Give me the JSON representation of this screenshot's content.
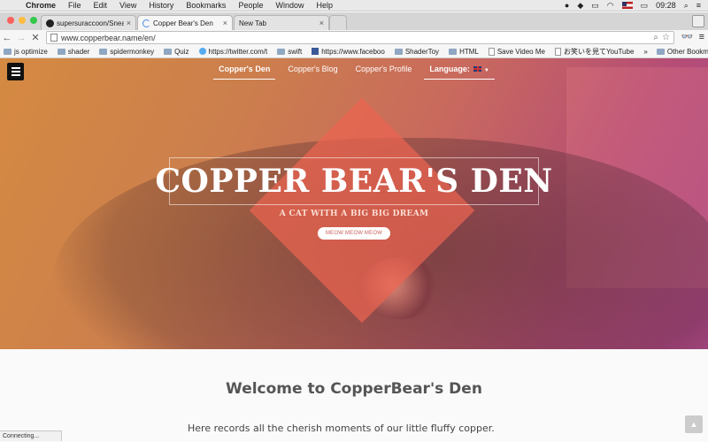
{
  "menubar": {
    "app": "Chrome",
    "items": [
      "File",
      "Edit",
      "View",
      "History",
      "Bookmarks",
      "People",
      "Window",
      "Help"
    ],
    "clock": "09:28"
  },
  "tabs": [
    {
      "title": "supersuraccoon/SneakyJo",
      "icon": "github-icon"
    },
    {
      "title": "Copper Bear's Den",
      "icon": "loading-spinner-icon"
    },
    {
      "title": "New Tab",
      "icon": ""
    }
  ],
  "toolbar": {
    "url": "www.copperbear.name/en/"
  },
  "bookmarks": [
    {
      "label": "js optimize",
      "icon": "folder-icon"
    },
    {
      "label": "shader",
      "icon": "folder-icon"
    },
    {
      "label": "spidermonkey",
      "icon": "folder-icon"
    },
    {
      "label": "Quiz",
      "icon": "folder-icon"
    },
    {
      "label": "https://twitter.com/t",
      "icon": "twitter-icon"
    },
    {
      "label": "swift",
      "icon": "folder-icon"
    },
    {
      "label": "https://www.faceboo",
      "icon": "facebook-icon"
    },
    {
      "label": "ShaderToy",
      "icon": "folder-icon"
    },
    {
      "label": "HTML",
      "icon": "folder-icon"
    },
    {
      "label": "Save Video Me",
      "icon": "document-icon"
    },
    {
      "label": "お笑いを見てYouTube",
      "icon": "document-icon"
    }
  ],
  "other_bookmarks": "Other Bookmarks",
  "site": {
    "nav": [
      {
        "label": "Copper's Den",
        "active": true
      },
      {
        "label": "Copper's Blog",
        "active": false
      },
      {
        "label": "Copper's Profile",
        "active": false
      }
    ],
    "language_label": "Language:",
    "hero_title": "COPPER BEAR'S DEN",
    "hero_subtitle": "A CAT WITH A BIG BIG DREAM",
    "cta": "MEOW MEOW MEOW",
    "welcome": "Welcome to CopperBear's Den",
    "lead": "Here records all the cherish moments of our little fluffy copper."
  },
  "status": "Connecting..."
}
